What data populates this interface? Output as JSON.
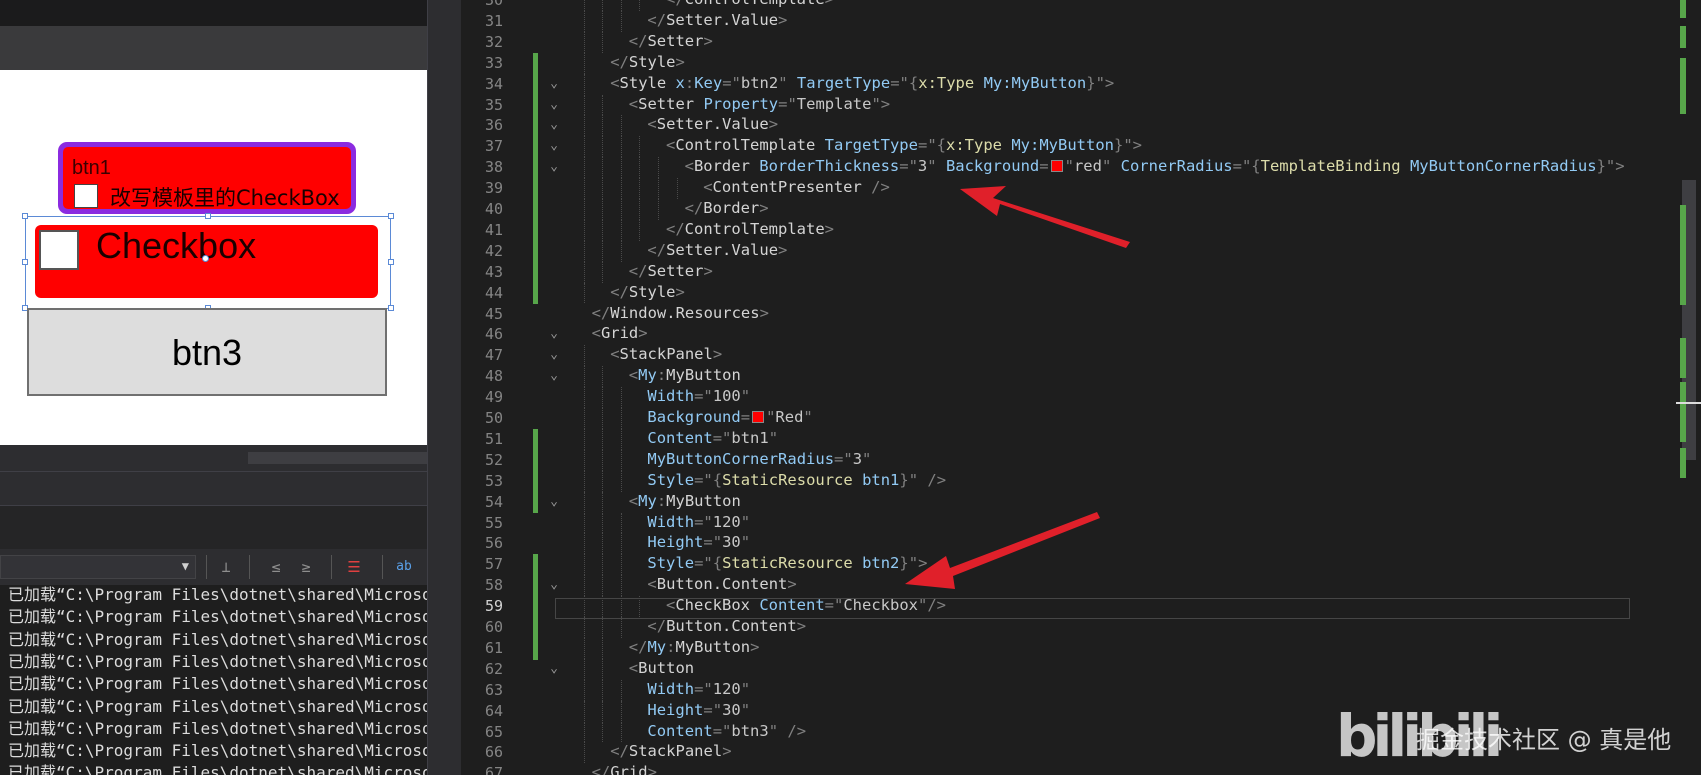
{
  "designer": {
    "btn1": {
      "label": "btn1",
      "checkbox_text": "改写模板里的CheckBox"
    },
    "btn2": {
      "checkbox_text": "Checkbox"
    },
    "btn3": {
      "label": "btn3"
    }
  },
  "output": {
    "lines": [
      "已加载“C:\\Program Files\\dotnet\\shared\\Microsof",
      "已加载“C:\\Program Files\\dotnet\\shared\\Microsof",
      "已加载“C:\\Program Files\\dotnet\\shared\\Microsof",
      "已加载“C:\\Program Files\\dotnet\\shared\\Microsof",
      "已加载“C:\\Program Files\\dotnet\\shared\\Microsof",
      "已加载“C:\\Program Files\\dotnet\\shared\\Microsof",
      "已加载“C:\\Program Files\\dotnet\\shared\\Microsof",
      "已加载“C:\\Program Files\\dotnet\\shared\\Microsof",
      "已加载“C:\\Program Files\\dotnet\\shared\\Microsof"
    ]
  },
  "editor": {
    "current_line": 59,
    "lines": [
      {
        "n": 30,
        "indent": 10,
        "changed": false,
        "fold": false,
        "tokens": [
          {
            "t": "</",
            "c": "punc"
          },
          {
            "t": "ControlTemplate",
            "c": "tag"
          },
          {
            "t": ">",
            "c": "punc"
          }
        ]
      },
      {
        "n": 31,
        "indent": 8,
        "changed": false,
        "fold": false,
        "tokens": [
          {
            "t": "</",
            "c": "punc"
          },
          {
            "t": "Setter.Value",
            "c": "tag"
          },
          {
            "t": ">",
            "c": "punc"
          }
        ]
      },
      {
        "n": 32,
        "indent": 6,
        "changed": false,
        "fold": false,
        "tokens": [
          {
            "t": "</",
            "c": "punc"
          },
          {
            "t": "Setter",
            "c": "tag"
          },
          {
            "t": ">",
            "c": "punc"
          }
        ]
      },
      {
        "n": 33,
        "indent": 4,
        "changed": true,
        "fold": false,
        "tokens": [
          {
            "t": "</",
            "c": "punc"
          },
          {
            "t": "Style",
            "c": "tag"
          },
          {
            "t": ">",
            "c": "punc"
          }
        ]
      },
      {
        "n": 34,
        "indent": 4,
        "changed": true,
        "fold": true,
        "tokens": [
          {
            "t": "<",
            "c": "punc"
          },
          {
            "t": "Style ",
            "c": "tag"
          },
          {
            "t": "x",
            "c": "attr"
          },
          {
            "t": ":",
            "c": "punc"
          },
          {
            "t": "Key",
            "c": "attr"
          },
          {
            "t": "=\"",
            "c": "punc"
          },
          {
            "t": "btn2",
            "c": "str"
          },
          {
            "t": "\" ",
            "c": "punc"
          },
          {
            "t": "TargetType",
            "c": "attr"
          },
          {
            "t": "=\"",
            "c": "punc"
          },
          {
            "t": "{",
            "c": "punc"
          },
          {
            "t": "x:Type ",
            "c": "ext"
          },
          {
            "t": "My:MyButton",
            "c": "attr"
          },
          {
            "t": "}",
            "c": "punc"
          },
          {
            "t": "\">",
            "c": "punc"
          }
        ]
      },
      {
        "n": 35,
        "indent": 6,
        "changed": true,
        "fold": true,
        "tokens": [
          {
            "t": "<",
            "c": "punc"
          },
          {
            "t": "Setter ",
            "c": "tag"
          },
          {
            "t": "Property",
            "c": "attr"
          },
          {
            "t": "=\"",
            "c": "punc"
          },
          {
            "t": "Template",
            "c": "str"
          },
          {
            "t": "\">",
            "c": "punc"
          }
        ]
      },
      {
        "n": 36,
        "indent": 8,
        "changed": true,
        "fold": true,
        "tokens": [
          {
            "t": "<",
            "c": "punc"
          },
          {
            "t": "Setter.Value",
            "c": "tag"
          },
          {
            "t": ">",
            "c": "punc"
          }
        ]
      },
      {
        "n": 37,
        "indent": 10,
        "changed": true,
        "fold": true,
        "tokens": [
          {
            "t": "<",
            "c": "punc"
          },
          {
            "t": "ControlTemplate ",
            "c": "tag"
          },
          {
            "t": "TargetType",
            "c": "attr"
          },
          {
            "t": "=\"",
            "c": "punc"
          },
          {
            "t": "{",
            "c": "punc"
          },
          {
            "t": "x:Type ",
            "c": "ext"
          },
          {
            "t": "My:MyButton",
            "c": "attr"
          },
          {
            "t": "}",
            "c": "punc"
          },
          {
            "t": "\">",
            "c": "punc"
          }
        ]
      },
      {
        "n": 38,
        "indent": 12,
        "changed": true,
        "fold": true,
        "tokens": [
          {
            "t": "<",
            "c": "punc"
          },
          {
            "t": "Border ",
            "c": "tag"
          },
          {
            "t": "BorderThickness",
            "c": "attr"
          },
          {
            "t": "=\"",
            "c": "punc"
          },
          {
            "t": "3",
            "c": "str"
          },
          {
            "t": "\" ",
            "c": "punc"
          },
          {
            "t": "Background",
            "c": "attr"
          },
          {
            "t": "=",
            "c": "punc"
          },
          {
            "t": "",
            "c": "swatch"
          },
          {
            "t": "\"",
            "c": "punc"
          },
          {
            "t": "red",
            "c": "str"
          },
          {
            "t": "\" ",
            "c": "punc"
          },
          {
            "t": "CornerRadius",
            "c": "attr"
          },
          {
            "t": "=\"",
            "c": "punc"
          },
          {
            "t": "{",
            "c": "punc"
          },
          {
            "t": "TemplateBinding ",
            "c": "ext"
          },
          {
            "t": "MyButtonCornerRadius",
            "c": "attr"
          },
          {
            "t": "}",
            "c": "punc"
          },
          {
            "t": "\">",
            "c": "punc"
          }
        ]
      },
      {
        "n": 39,
        "indent": 14,
        "changed": true,
        "fold": false,
        "tokens": [
          {
            "t": "<",
            "c": "punc"
          },
          {
            "t": "ContentPresenter ",
            "c": "tag"
          },
          {
            "t": "/>",
            "c": "punc"
          }
        ]
      },
      {
        "n": 40,
        "indent": 12,
        "changed": true,
        "fold": false,
        "tokens": [
          {
            "t": "</",
            "c": "punc"
          },
          {
            "t": "Border",
            "c": "tag"
          },
          {
            "t": ">",
            "c": "punc"
          }
        ]
      },
      {
        "n": 41,
        "indent": 10,
        "changed": true,
        "fold": false,
        "tokens": [
          {
            "t": "</",
            "c": "punc"
          },
          {
            "t": "ControlTemplate",
            "c": "tag"
          },
          {
            "t": ">",
            "c": "punc"
          }
        ]
      },
      {
        "n": 42,
        "indent": 8,
        "changed": true,
        "fold": false,
        "tokens": [
          {
            "t": "</",
            "c": "punc"
          },
          {
            "t": "Setter.Value",
            "c": "tag"
          },
          {
            "t": ">",
            "c": "punc"
          }
        ]
      },
      {
        "n": 43,
        "indent": 6,
        "changed": true,
        "fold": false,
        "tokens": [
          {
            "t": "</",
            "c": "punc"
          },
          {
            "t": "Setter",
            "c": "tag"
          },
          {
            "t": ">",
            "c": "punc"
          }
        ]
      },
      {
        "n": 44,
        "indent": 4,
        "changed": true,
        "fold": false,
        "tokens": [
          {
            "t": "</",
            "c": "punc"
          },
          {
            "t": "Style",
            "c": "tag"
          },
          {
            "t": ">",
            "c": "punc"
          }
        ]
      },
      {
        "n": 45,
        "indent": 2,
        "changed": false,
        "fold": false,
        "tokens": [
          {
            "t": "</",
            "c": "punc"
          },
          {
            "t": "Window.Resources",
            "c": "tag"
          },
          {
            "t": ">",
            "c": "punc"
          }
        ]
      },
      {
        "n": 46,
        "indent": 2,
        "changed": false,
        "fold": true,
        "tokens": [
          {
            "t": "<",
            "c": "punc"
          },
          {
            "t": "Grid",
            "c": "tag"
          },
          {
            "t": ">",
            "c": "punc"
          }
        ]
      },
      {
        "n": 47,
        "indent": 4,
        "changed": false,
        "fold": true,
        "tokens": [
          {
            "t": "<",
            "c": "punc"
          },
          {
            "t": "StackPanel",
            "c": "tag"
          },
          {
            "t": ">",
            "c": "punc"
          }
        ]
      },
      {
        "n": 48,
        "indent": 6,
        "changed": false,
        "fold": true,
        "tokens": [
          {
            "t": "<",
            "c": "punc"
          },
          {
            "t": "My",
            "c": "attr"
          },
          {
            "t": ":",
            "c": "punc"
          },
          {
            "t": "MyButton",
            "c": "tag"
          }
        ]
      },
      {
        "n": 49,
        "indent": 8,
        "changed": false,
        "fold": false,
        "tokens": [
          {
            "t": "Width",
            "c": "attr"
          },
          {
            "t": "=\"",
            "c": "punc"
          },
          {
            "t": "100",
            "c": "str"
          },
          {
            "t": "\"",
            "c": "punc"
          }
        ]
      },
      {
        "n": 50,
        "indent": 8,
        "changed": false,
        "fold": false,
        "tokens": [
          {
            "t": "Background",
            "c": "attr"
          },
          {
            "t": "=",
            "c": "punc"
          },
          {
            "t": "",
            "c": "swatch"
          },
          {
            "t": "\"",
            "c": "punc"
          },
          {
            "t": "Red",
            "c": "str"
          },
          {
            "t": "\"",
            "c": "punc"
          }
        ]
      },
      {
        "n": 51,
        "indent": 8,
        "changed": true,
        "fold": false,
        "tokens": [
          {
            "t": "Content",
            "c": "attr"
          },
          {
            "t": "=\"",
            "c": "punc"
          },
          {
            "t": "btn1",
            "c": "str"
          },
          {
            "t": "\"",
            "c": "punc"
          }
        ]
      },
      {
        "n": 52,
        "indent": 8,
        "changed": true,
        "fold": false,
        "tokens": [
          {
            "t": "MyButtonCornerRadius",
            "c": "attr"
          },
          {
            "t": "=\"",
            "c": "punc"
          },
          {
            "t": "3",
            "c": "str"
          },
          {
            "t": "\"",
            "c": "punc"
          }
        ]
      },
      {
        "n": 53,
        "indent": 8,
        "changed": true,
        "fold": false,
        "tokens": [
          {
            "t": "Style",
            "c": "attr"
          },
          {
            "t": "=\"",
            "c": "punc"
          },
          {
            "t": "{",
            "c": "punc"
          },
          {
            "t": "StaticResource ",
            "c": "ext"
          },
          {
            "t": "btn1",
            "c": "attr"
          },
          {
            "t": "}",
            "c": "punc"
          },
          {
            "t": "\" />",
            "c": "punc"
          }
        ]
      },
      {
        "n": 54,
        "indent": 6,
        "changed": true,
        "fold": true,
        "tokens": [
          {
            "t": "<",
            "c": "punc"
          },
          {
            "t": "My",
            "c": "attr"
          },
          {
            "t": ":",
            "c": "punc"
          },
          {
            "t": "MyButton",
            "c": "tag"
          }
        ]
      },
      {
        "n": 55,
        "indent": 8,
        "changed": false,
        "fold": false,
        "tokens": [
          {
            "t": "Width",
            "c": "attr"
          },
          {
            "t": "=\"",
            "c": "punc"
          },
          {
            "t": "120",
            "c": "str"
          },
          {
            "t": "\"",
            "c": "punc"
          }
        ]
      },
      {
        "n": 56,
        "indent": 8,
        "changed": false,
        "fold": false,
        "tokens": [
          {
            "t": "Height",
            "c": "attr"
          },
          {
            "t": "=\"",
            "c": "punc"
          },
          {
            "t": "30",
            "c": "str"
          },
          {
            "t": "\"",
            "c": "punc"
          }
        ]
      },
      {
        "n": 57,
        "indent": 8,
        "changed": true,
        "fold": false,
        "tokens": [
          {
            "t": "Style",
            "c": "attr"
          },
          {
            "t": "=\"",
            "c": "punc"
          },
          {
            "t": "{",
            "c": "punc"
          },
          {
            "t": "StaticResource ",
            "c": "ext"
          },
          {
            "t": "btn2",
            "c": "attr"
          },
          {
            "t": "}",
            "c": "punc"
          },
          {
            "t": "\">",
            "c": "punc"
          }
        ]
      },
      {
        "n": 58,
        "indent": 8,
        "changed": true,
        "fold": true,
        "tokens": [
          {
            "t": "<",
            "c": "punc"
          },
          {
            "t": "Button.Content",
            "c": "tag"
          },
          {
            "t": ">",
            "c": "punc"
          }
        ]
      },
      {
        "n": 59,
        "indent": 10,
        "changed": true,
        "fold": false,
        "tokens": [
          {
            "t": "<",
            "c": "punc"
          },
          {
            "t": "CheckBox ",
            "c": "tag"
          },
          {
            "t": "Content",
            "c": "attr"
          },
          {
            "t": "=\"",
            "c": "punc"
          },
          {
            "t": "Checkbox",
            "c": "str"
          },
          {
            "t": "\"/>",
            "c": "punc"
          }
        ]
      },
      {
        "n": 60,
        "indent": 8,
        "changed": true,
        "fold": false,
        "tokens": [
          {
            "t": "</",
            "c": "punc"
          },
          {
            "t": "Button.Content",
            "c": "tag"
          },
          {
            "t": ">",
            "c": "punc"
          }
        ]
      },
      {
        "n": 61,
        "indent": 6,
        "changed": true,
        "fold": false,
        "tokens": [
          {
            "t": "</",
            "c": "punc"
          },
          {
            "t": "My",
            "c": "attr"
          },
          {
            "t": ":",
            "c": "punc"
          },
          {
            "t": "MyButton",
            "c": "tag"
          },
          {
            "t": ">",
            "c": "punc"
          }
        ]
      },
      {
        "n": 62,
        "indent": 6,
        "changed": false,
        "fold": true,
        "tokens": [
          {
            "t": "<",
            "c": "punc"
          },
          {
            "t": "Button",
            "c": "tag"
          }
        ]
      },
      {
        "n": 63,
        "indent": 8,
        "changed": false,
        "fold": false,
        "tokens": [
          {
            "t": "Width",
            "c": "attr"
          },
          {
            "t": "=\"",
            "c": "punc"
          },
          {
            "t": "120",
            "c": "str"
          },
          {
            "t": "\"",
            "c": "punc"
          }
        ]
      },
      {
        "n": 64,
        "indent": 8,
        "changed": false,
        "fold": false,
        "tokens": [
          {
            "t": "Height",
            "c": "attr"
          },
          {
            "t": "=\"",
            "c": "punc"
          },
          {
            "t": "30",
            "c": "str"
          },
          {
            "t": "\"",
            "c": "punc"
          }
        ]
      },
      {
        "n": 65,
        "indent": 8,
        "changed": false,
        "fold": false,
        "tokens": [
          {
            "t": "Content",
            "c": "attr"
          },
          {
            "t": "=\"",
            "c": "punc"
          },
          {
            "t": "btn3",
            "c": "str"
          },
          {
            "t": "\" />",
            "c": "punc"
          }
        ]
      },
      {
        "n": 66,
        "indent": 4,
        "changed": false,
        "fold": false,
        "tokens": [
          {
            "t": "</",
            "c": "punc"
          },
          {
            "t": "StackPanel",
            "c": "tag"
          },
          {
            "t": ">",
            "c": "punc"
          }
        ]
      },
      {
        "n": 67,
        "indent": 2,
        "changed": false,
        "fold": false,
        "tokens": [
          {
            "t": "</",
            "c": "punc"
          },
          {
            "t": "Grid",
            "c": "tag"
          },
          {
            "t": ">",
            "c": "punc"
          }
        ]
      }
    ]
  },
  "watermark": {
    "logo": "bilibili",
    "text": "掘金技术社区 @ 真是他"
  },
  "colors": {
    "accent_purple": "#8b2be0",
    "button_red": "#ff0000",
    "change_green": "#57a64a",
    "arrow_red": "#e0202a"
  }
}
